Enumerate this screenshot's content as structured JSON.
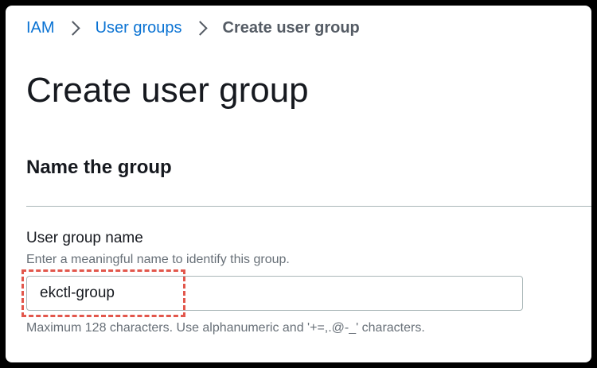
{
  "breadcrumb": {
    "items": [
      {
        "label": "IAM"
      },
      {
        "label": "User groups"
      },
      {
        "label": "Create user group"
      }
    ]
  },
  "page": {
    "title": "Create user group"
  },
  "section": {
    "title": "Name the group",
    "field": {
      "label": "User group name",
      "description": "Enter a meaningful name to identify this group.",
      "value": "ekctl-group",
      "constraint": "Maximum 128 characters. Use alphanumeric and '+=,.@-_' characters."
    }
  },
  "colors": {
    "link": "#0972d3",
    "highlight_border": "#e2574c",
    "divider": "#aab7b8"
  },
  "icons": {
    "breadcrumb_separator": "chevron-right-icon"
  }
}
